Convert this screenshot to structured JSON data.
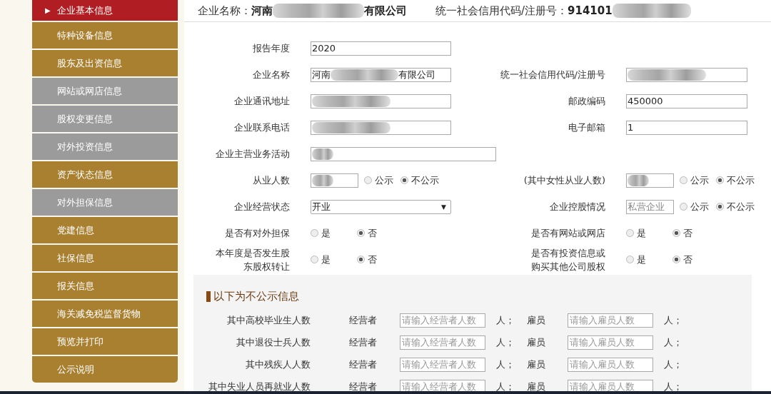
{
  "sidebar": {
    "items": [
      {
        "label": "企业基本信息",
        "selected": true,
        "marker": "▶"
      },
      {
        "label": "特种设备信息",
        "selected": false,
        "color": "#a98030"
      },
      {
        "label": "股东及出资信息",
        "selected": false,
        "color": "#a98030"
      },
      {
        "label": "网站或网店信息",
        "selected": false,
        "color": "#9b9b9b"
      },
      {
        "label": "股权变更信息",
        "selected": false,
        "color": "#9b9b9b"
      },
      {
        "label": "对外投资信息",
        "selected": false,
        "color": "#9b9b9b"
      },
      {
        "label": "资产状态信息",
        "selected": false,
        "color": "#a98030"
      },
      {
        "label": "对外担保信息",
        "selected": false,
        "color": "#9b9b9b"
      },
      {
        "label": "党建信息",
        "selected": false,
        "color": "#a98030"
      },
      {
        "label": "社保信息",
        "selected": false,
        "color": "#a98030"
      },
      {
        "label": "报关信息",
        "selected": false,
        "color": "#a98030"
      },
      {
        "label": "海关减免税监督货物",
        "selected": false,
        "color": "#a98030"
      },
      {
        "label": "预览并打印",
        "selected": false,
        "color": "#a98030"
      },
      {
        "label": "公示说明",
        "selected": false,
        "color": "#a98030"
      }
    ]
  },
  "header": {
    "company_label": "企业名称：",
    "company_name_start": "河南",
    "company_name_end": "有限公司",
    "code_label": "统一社会信用代码/注册号：",
    "code_start": "914101"
  },
  "form": {
    "rows": [
      {
        "left": {
          "label": "报告年度",
          "kind": "text",
          "value": "2020"
        }
      },
      {
        "left": {
          "label": "企业名称",
          "kind": "text",
          "value": "河南",
          "value_end": "有限公司",
          "redacted": true
        },
        "right": {
          "label": "统一社会信用代码/注册号",
          "kind": "text",
          "redacted": true
        }
      },
      {
        "left": {
          "label": "企业通讯地址",
          "kind": "text",
          "redacted": true
        },
        "right": {
          "label": "邮政编码",
          "kind": "text",
          "value": "450000"
        }
      },
      {
        "left": {
          "label": "企业联系电话",
          "kind": "text",
          "redacted": true
        },
        "right": {
          "label": "电子邮箱",
          "kind": "text",
          "value": "1"
        }
      },
      {
        "left": {
          "label": "企业主营业务活动",
          "kind": "wide",
          "redacted": true
        }
      },
      {
        "left": {
          "label": "从业人数",
          "kind": "count",
          "redacted": true,
          "options": [
            {
              "label": "公示",
              "selected": false
            },
            {
              "label": "不公示",
              "selected": true
            }
          ]
        },
        "right": {
          "label": "(其中女性从业人数)",
          "kind": "count",
          "redacted": true,
          "options": [
            {
              "label": "公示",
              "selected": false
            },
            {
              "label": "不公示",
              "selected": true
            }
          ]
        }
      },
      {
        "left": {
          "label": "企业经营状态",
          "kind": "select",
          "value": "开业",
          "caret": "▼"
        },
        "right": {
          "label": "企业控股情况",
          "kind": "count",
          "placeholder": "私营企业",
          "options": [
            {
              "label": "公示",
              "selected": false
            },
            {
              "label": "不公示",
              "selected": true
            }
          ]
        }
      },
      {
        "left": {
          "label": "是否有对外担保",
          "kind": "choice",
          "options": [
            {
              "label": "是",
              "selected": false
            },
            {
              "label": "否",
              "selected": true
            }
          ]
        },
        "right": {
          "label": "是否有网站或网店",
          "kind": "choice",
          "options": [
            {
              "label": "是",
              "selected": false
            },
            {
              "label": "否",
              "selected": true
            }
          ]
        }
      },
      {
        "left": {
          "label_lines": [
            "本年度是否发生股",
            "东股权转让"
          ],
          "kind": "choice",
          "options": [
            {
              "label": "是",
              "selected": false
            },
            {
              "label": "否",
              "selected": true
            }
          ]
        },
        "right": {
          "label_lines": [
            "是否有投资信息或",
            "购买其他公司股权"
          ],
          "kind": "choice",
          "options": [
            {
              "label": "是",
              "selected": false
            },
            {
              "label": "否",
              "selected": true
            }
          ]
        }
      }
    ]
  },
  "private": {
    "title": "以下为不公示信息",
    "rows": [
      {
        "label": "其中高校毕业生人数",
        "owner_label": "经营者",
        "owner_placeholder": "请输入经营者人数",
        "owner_unit": "人；",
        "employee_label": "雇员",
        "employee_placeholder": "请输入雇员人数",
        "employee_unit": "人；"
      },
      {
        "label": "其中退役士兵人数",
        "owner_label": "经营者",
        "owner_placeholder": "请输入经营者人数",
        "owner_unit": "人；",
        "employee_label": "雇员",
        "employee_placeholder": "请输入雇员人数",
        "employee_unit": "人；"
      },
      {
        "label": "其中残疾人人数",
        "owner_label": "经营者",
        "owner_placeholder": "请输入经营者人数",
        "owner_unit": "人；",
        "employee_label": "雇员",
        "employee_placeholder": "请输入雇员人数",
        "employee_unit": "人；"
      },
      {
        "label": "其中失业人员再就业人数",
        "owner_label": "经营者",
        "owner_placeholder": "请输入经营者人数",
        "owner_unit": "人；",
        "employee_label": "雇员",
        "employee_placeholder": "请输入雇员人数",
        "employee_unit": "人；"
      }
    ]
  }
}
